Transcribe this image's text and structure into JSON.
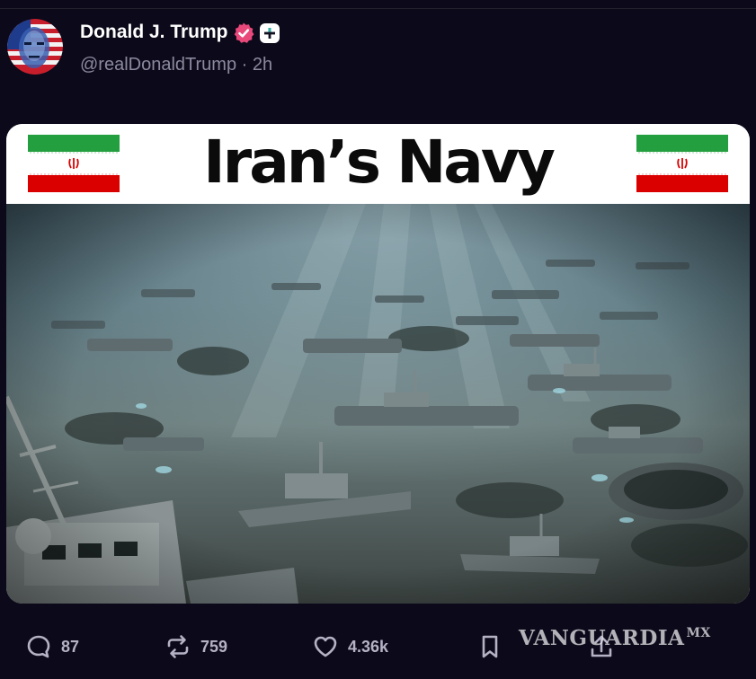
{
  "post": {
    "author_name": "Donald J. Trump",
    "handle": "@realDonaldTrump",
    "separator": "·",
    "time": "2h",
    "verified_icon": "verified-badge-icon",
    "plus_icon": "plus-icon"
  },
  "media": {
    "banner_title": "Iran’s Navy",
    "flag_icon": "iran-flag-icon",
    "scene": "underwater-shipwreck-image"
  },
  "actions": {
    "replies": {
      "icon": "comment-icon",
      "count": "87"
    },
    "reposts": {
      "icon": "repost-icon",
      "count": "759"
    },
    "likes": {
      "icon": "heart-icon",
      "count": "4.36k"
    },
    "bookmark": {
      "icon": "bookmark-icon"
    },
    "share": {
      "icon": "share-icon"
    }
  },
  "watermark": "VANGUARDIA",
  "colors": {
    "background": "#0c0a1a",
    "verified_badge": "#e8487a",
    "flag_green": "#239f40",
    "flag_red": "#da0000",
    "muted_text": "#8b899e"
  }
}
